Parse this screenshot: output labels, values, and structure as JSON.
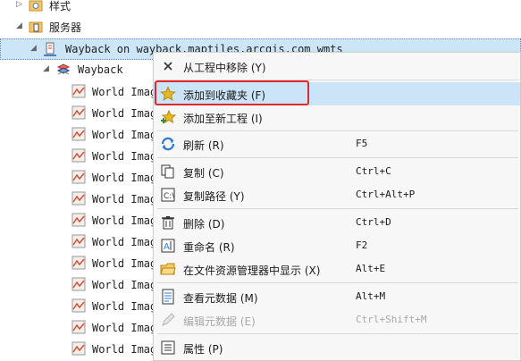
{
  "tree": {
    "styles_label": "样式",
    "servers_label": "服务器",
    "wmts_label": "Wayback on wayback.maptiles.arcgis.com wmts",
    "wayback_label": "Wayback",
    "imagery_items": [
      "World Imager",
      "World Imager",
      "World Imager",
      "World Imager",
      "World Imager",
      "World Imager",
      "World Imager",
      "World Imager",
      "World Imager",
      "World Imager",
      "World Imager",
      "World Imager",
      "World Imager"
    ]
  },
  "menu": {
    "remove": {
      "label": "从工程中移除 (Y)",
      "shortcut": ""
    },
    "add_fav": {
      "label": "添加到收藏夹 (F)",
      "shortcut": ""
    },
    "add_new": {
      "label": "添加至新工程 (I)",
      "shortcut": ""
    },
    "refresh": {
      "label": "刷新 (R)",
      "shortcut": "F5"
    },
    "copy": {
      "label": "复制 (C)",
      "shortcut": "Ctrl+C"
    },
    "copy_path": {
      "label": "复制路径 (Y)",
      "shortcut": "Ctrl+Alt+P"
    },
    "delete": {
      "label": "删除 (D)",
      "shortcut": "Ctrl+D"
    },
    "rename": {
      "label": "重命名 (R)",
      "shortcut": "F2"
    },
    "show_explorer": {
      "label": "在文件资源管理器中显示 (X)",
      "shortcut": "Alt+E"
    },
    "view_meta": {
      "label": "查看元数据 (M)",
      "shortcut": "Alt+M"
    },
    "edit_meta": {
      "label": "编辑元数据 (E)",
      "shortcut": "Ctrl+Shift+M"
    },
    "properties": {
      "label": "属性 (P)",
      "shortcut": ""
    }
  },
  "colors": {
    "highlight": "#cce4f7",
    "selection": "#cde6f7",
    "annotation_box": "#e0282e",
    "star": "#e8b820"
  }
}
